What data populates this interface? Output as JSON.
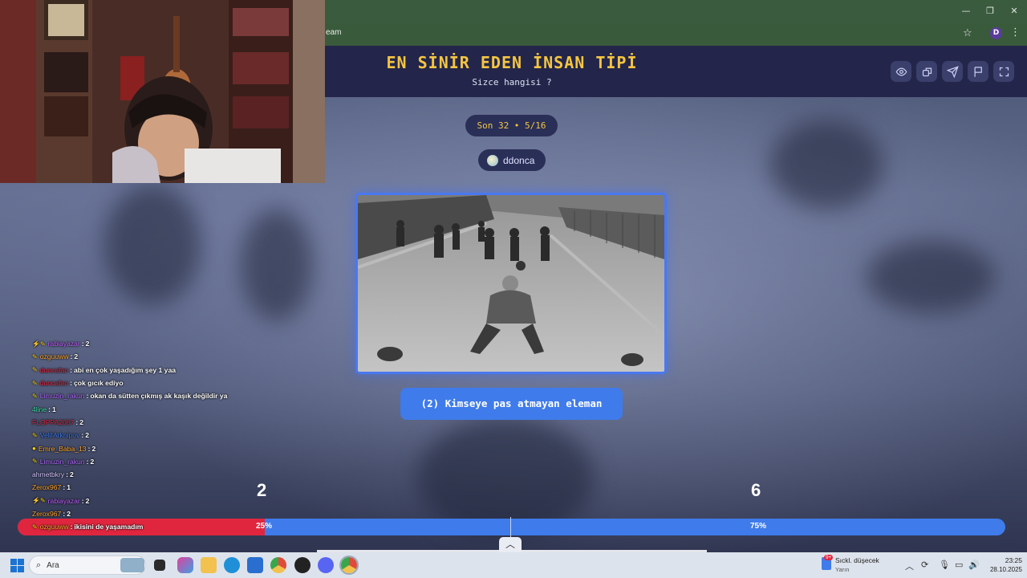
{
  "browser": {
    "url_fragment": "eam",
    "window_controls": {
      "minimize": "—",
      "restore": "❐",
      "close": "✕"
    },
    "profile_initial": "D"
  },
  "page": {
    "title": "EN SİNİR EDEN İNSAN TİPİ",
    "subtitle": "Sizce hangisi ?",
    "header_buttons": [
      "eye-icon",
      "share-icon",
      "send-icon",
      "flag-icon",
      "fullscreen-icon"
    ],
    "round_label": "Son 32 • 5/16",
    "user": {
      "name": "ddonca"
    },
    "choice_label": "(2) Kimseye pas atmayan eleman"
  },
  "vote": {
    "left_count": "2",
    "right_count": "6",
    "left_percent": "25%",
    "right_percent": "75%",
    "left_fraction": 0.25,
    "collapse_symbol": "︿"
  },
  "chat": {
    "lines": [
      {
        "badge": "⚡✎",
        "user": "rabiayazar",
        "color": "#c061ff",
        "msg": "2"
      },
      {
        "badge": "✎",
        "user": "ozguuww",
        "color": "#ffa62b",
        "msg": "2"
      },
      {
        "badge": "✎",
        "user": "duncafan",
        "color": "#e0263f",
        "msg": "abi en çok yaşadığım şey 1 yaa"
      },
      {
        "badge": "✎",
        "user": "duncafan",
        "color": "#e0263f",
        "msg": "çok gıcık ediyo"
      },
      {
        "badge": "✎",
        "user": "Limuzin_rakun",
        "color": "#b169ff",
        "msg": "okan da sütten çıkmış ak kaşık değildir ya"
      },
      {
        "badge": "",
        "user": "4line",
        "color": "#3fe0a8",
        "msg": "1"
      },
      {
        "badge": "",
        "user": "FLOPPA2067",
        "color": "#e0263f",
        "msg": "2"
      },
      {
        "badge": "✎",
        "user": "VeliIArknipov",
        "color": "#3f7bea",
        "msg": "2"
      },
      {
        "badge": "●",
        "user": "Emre_Baba_13",
        "color": "#ffa62b",
        "msg": "2"
      },
      {
        "badge": "✎",
        "user": "Limuzin_rakun",
        "color": "#b169ff",
        "msg": "2"
      },
      {
        "badge": "",
        "user": "ahmetbkry",
        "color": "#d8c8ff",
        "msg": "2"
      },
      {
        "badge": "",
        "user": "Zerox967",
        "color": "#ffa62b",
        "msg": "1"
      },
      {
        "badge": "⚡✎",
        "user": "rabiayazar",
        "color": "#c061ff",
        "msg": "2"
      },
      {
        "badge": "",
        "user": "Zerox967",
        "color": "#ffa62b",
        "msg": "2"
      },
      {
        "badge": "✎",
        "user": "ozguuww",
        "color": "#ffa62b",
        "msg": "ikisini de yaşamadım"
      }
    ]
  },
  "taskbar": {
    "search_placeholder": "Ara",
    "weather_title": "Sıckl. düşecek",
    "weather_subtitle": "Yarın",
    "weather_badge": "9+",
    "time": "23:25",
    "date": "28.10.2025"
  }
}
